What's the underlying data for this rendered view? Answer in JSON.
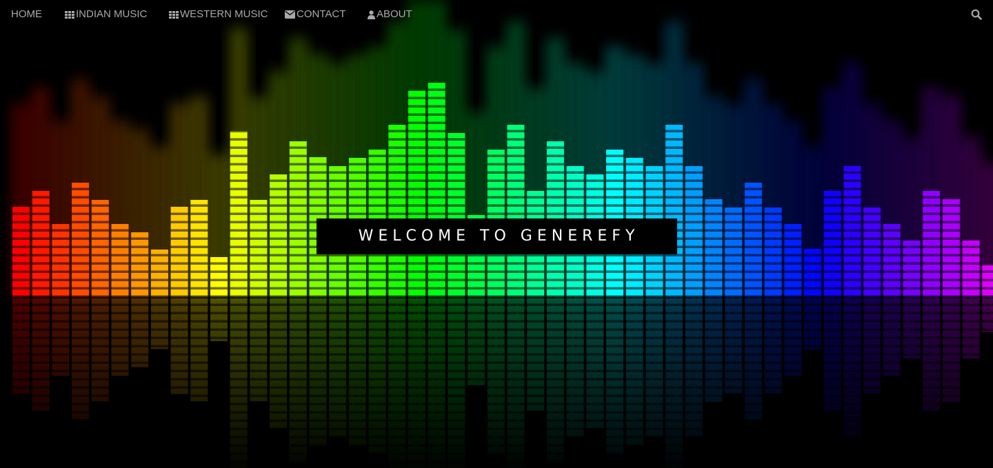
{
  "nav": {
    "items": [
      {
        "label": "HOME",
        "icon": "none"
      },
      {
        "label": "INDIAN MUSIC",
        "icon": "grid-icon"
      },
      {
        "label": "WESTERN MUSIC",
        "icon": "grid-icon"
      },
      {
        "label": "CONTACT",
        "icon": "envelope-icon"
      },
      {
        "label": "ABOUT",
        "icon": "user-icon"
      }
    ],
    "search_icon": "search-icon",
    "text_color": "#a9a9a9"
  },
  "hero": {
    "title": "WELCOME TO GENEREFY"
  },
  "background": {
    "type": "rainbow audio equalizer",
    "colors": [
      "#ff0000",
      "#ff7a00",
      "#ffe600",
      "#9cff00",
      "#00ff33",
      "#00ffd5",
      "#0080ff",
      "#6a00ff",
      "#d400ff"
    ]
  }
}
